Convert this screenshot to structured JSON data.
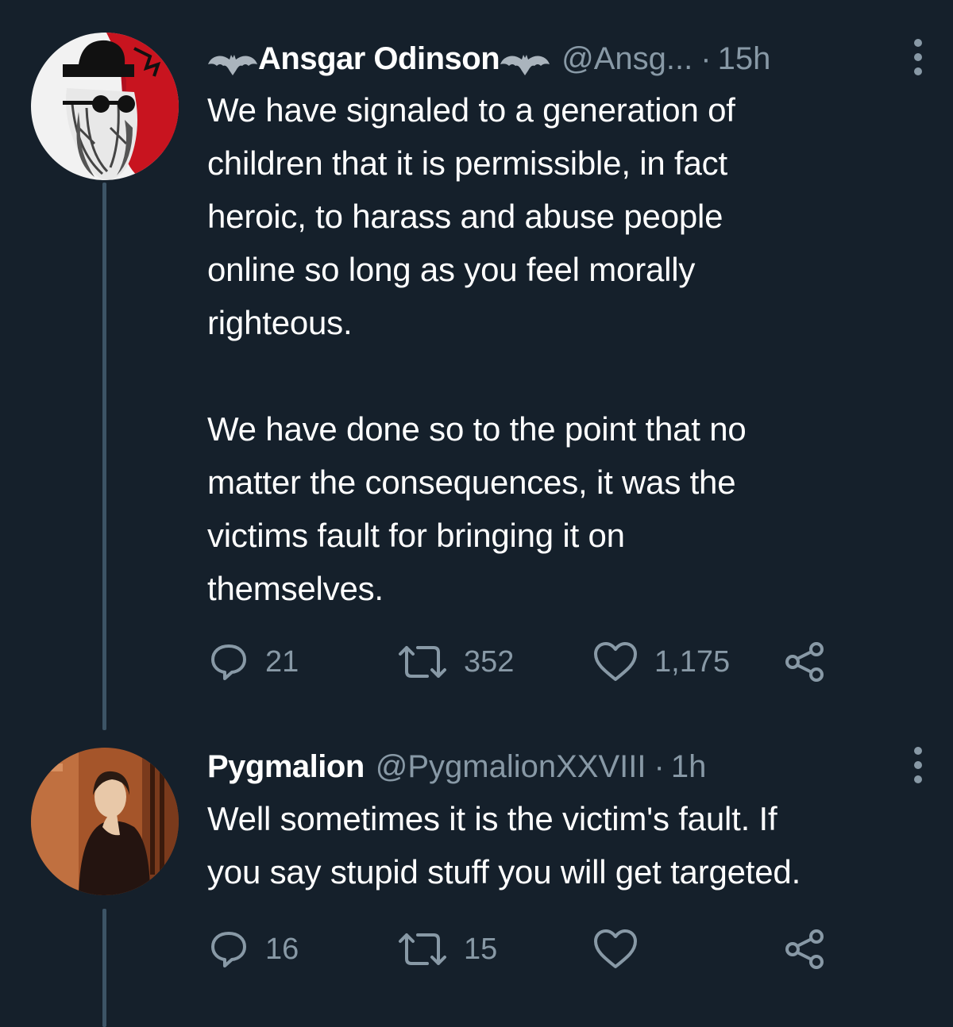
{
  "tweets": [
    {
      "name": "Ansgar Odinson",
      "handle": "@Ansg...",
      "separator": "·",
      "time": "15h",
      "text": "We have signaled to a generation of\nchildren that it is permissible, in fact\nheroic, to harass and abuse people\nonline so long as you feel morally\nrighteous.\n\nWe have done so to the point that no\nmatter the consequences, it was the\nvictims fault for bringing it on\nthemselves.",
      "replies": "21",
      "retweets": "352",
      "likes": "1,175"
    },
    {
      "name": "Pygmalion",
      "handle": "@PygmalionXXVIII",
      "separator": "·",
      "time": "1h",
      "text": "Well sometimes it is the victim's fault. If\nyou say stupid stuff you will get targeted.",
      "replies": "16",
      "retweets": "15",
      "likes": ""
    }
  ],
  "icons": {
    "reply": "reply-icon",
    "retweet": "retweet-icon",
    "like": "heart-icon",
    "share": "share-icon",
    "more": "more-vertical-icon",
    "name_decoration": "bat-icon"
  },
  "colors": {
    "background": "#15202b",
    "text": "#ffffff",
    "secondary": "#8899a6",
    "thread_line": "#3d5466"
  }
}
